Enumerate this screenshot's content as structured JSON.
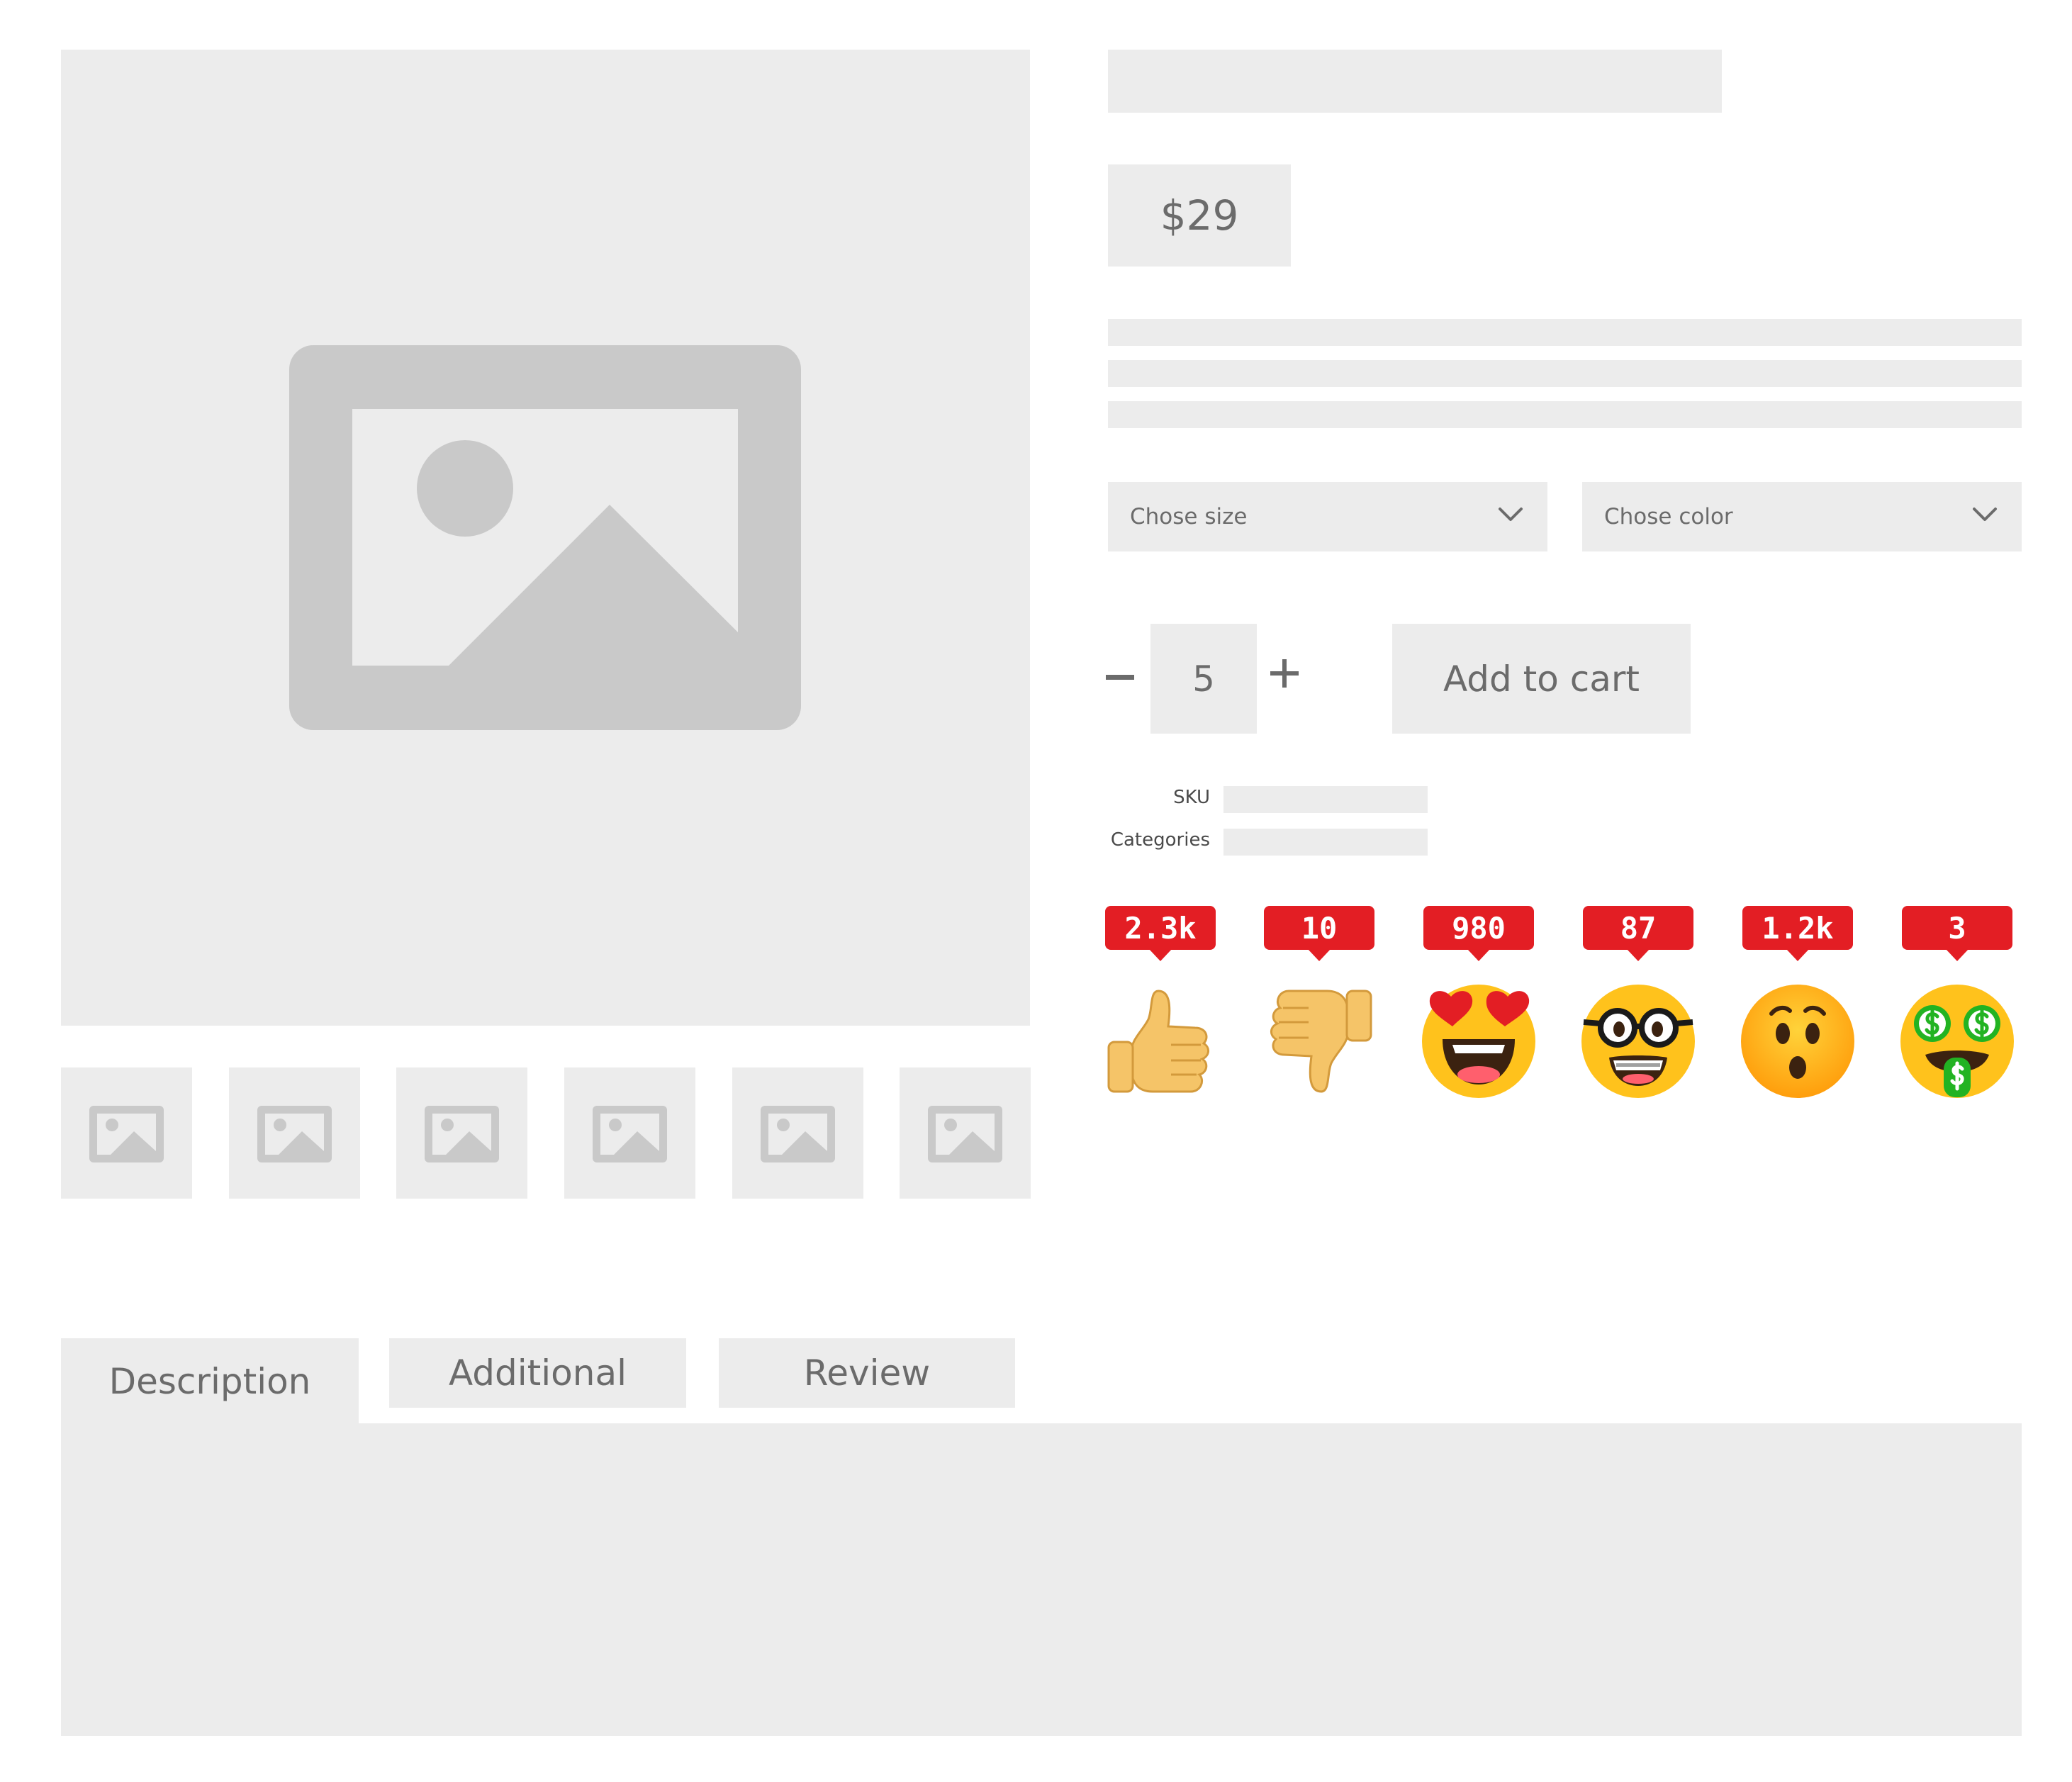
{
  "product": {
    "price": "$29",
    "size_select": {
      "selected": "Chose size"
    },
    "color_select": {
      "selected": "Chose color"
    },
    "quantity": "5",
    "add_to_cart_label": "Add to cart",
    "meta": {
      "sku_label": "SKU",
      "categories_label": "Categories"
    }
  },
  "icons": {
    "main_image": "image-placeholder-icon",
    "thumbnail": "image-placeholder-icon",
    "select_arrow": "chevron-down-icon",
    "qty_minus": "minus-icon",
    "qty_plus": "plus-icon"
  },
  "reactions": [
    {
      "emoji": "thumbs-up",
      "count": "2.3k"
    },
    {
      "emoji": "thumbs-down",
      "count": "10"
    },
    {
      "emoji": "heart-eyes",
      "count": "980"
    },
    {
      "emoji": "nerd-face",
      "count": "87"
    },
    {
      "emoji": "surprised-face",
      "count": "1.2k"
    },
    {
      "emoji": "money-face",
      "count": "3"
    }
  ],
  "tabs": [
    {
      "label": "Description",
      "active": true
    },
    {
      "label": "Additional",
      "active": false
    },
    {
      "label": "Review",
      "active": false
    }
  ],
  "colors": {
    "placeholder": "#ececec",
    "icon_gray": "#c9c9c9",
    "text": "#6b6b6b",
    "badge": "#e31e24"
  }
}
